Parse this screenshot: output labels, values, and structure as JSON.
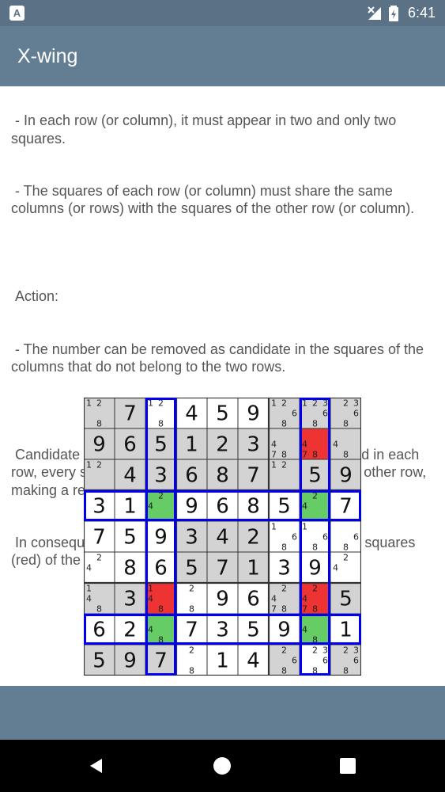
{
  "status_bar": {
    "app_icon_letter": "A",
    "time": "6:41"
  },
  "app_bar": {
    "title": "X-wing"
  },
  "description": {
    "paragraphs": [
      " - In each row (or column), it must appear in two and only two squares.",
      " - The squares of each row (or column) must share the same columns (or rows) with the squares of the other row (or column).",
      "",
      " Action:",
      " - The number can be removed as candidate in the squares of the columns that do not belong to the two rows.",
      "",
      " Candidate 4 appears only twice in the marked rows, and in each row, every square shares column with the square of the other row, making a rectangle (green squares).",
      " In consequence, 4 can be removed as candidate in the squares (red) of the columns that do not belong to the two rows:"
    ]
  },
  "sudoku": {
    "cells": [
      [
        "c:12 8",
        "7",
        "c:12 8",
        "4",
        "5",
        "9",
        "c:12 6 8",
        "c:123 6 8",
        "c:23 6 8"
      ],
      [
        "9",
        "6",
        "5",
        "1",
        "2",
        "3",
        "c:4 78",
        "c:4 78",
        "c:4 8"
      ],
      [
        "c:12",
        "4",
        "3",
        "6",
        "8",
        "7",
        "c:12",
        "5",
        "9"
      ],
      [
        "3",
        "1",
        "c:4 2",
        "9",
        "6",
        "8",
        "5",
        "c:4 2",
        "7"
      ],
      [
        "7",
        "5",
        "9",
        "3",
        "4",
        "2",
        "c:1 6 8",
        "c:1 6 8",
        "c:6 8"
      ],
      [
        "c:4 2",
        "8",
        "6",
        "5",
        "7",
        "1",
        "3",
        "9",
        "c:4 2"
      ],
      [
        "c:1 4 8",
        "3",
        "c:1 4 8",
        "c:2 8",
        "9",
        "6",
        "c:2 4 78",
        "c:2 4 78",
        "5"
      ],
      [
        "6",
        "2",
        "c:4 8",
        "7",
        "3",
        "5",
        "9",
        "c:4 8",
        "1"
      ],
      [
        "5",
        "9",
        "7",
        "c:2 8",
        "1",
        "4",
        "c:2 6 8",
        "c:23 6 8",
        "c:23 6 8"
      ]
    ],
    "gray_cells": [
      [
        0,
        0
      ],
      [
        0,
        1
      ],
      [
        0,
        6
      ],
      [
        0,
        7
      ],
      [
        0,
        8
      ],
      [
        1,
        0
      ],
      [
        1,
        1
      ],
      [
        1,
        2
      ],
      [
        1,
        3
      ],
      [
        1,
        4
      ],
      [
        1,
        5
      ],
      [
        1,
        6
      ],
      [
        1,
        8
      ],
      [
        2,
        0
      ],
      [
        2,
        1
      ],
      [
        2,
        2
      ],
      [
        2,
        3
      ],
      [
        2,
        4
      ],
      [
        2,
        5
      ],
      [
        2,
        6
      ],
      [
        2,
        7
      ],
      [
        2,
        8
      ],
      [
        4,
        3
      ],
      [
        4,
        4
      ],
      [
        4,
        5
      ],
      [
        5,
        3
      ],
      [
        5,
        4
      ],
      [
        5,
        5
      ],
      [
        6,
        0
      ],
      [
        6,
        1
      ],
      [
        6,
        6
      ],
      [
        6,
        8
      ],
      [
        8,
        0
      ],
      [
        8,
        1
      ],
      [
        8,
        2
      ],
      [
        8,
        6
      ],
      [
        8,
        8
      ]
    ],
    "green_cells": [
      [
        3,
        2
      ],
      [
        3,
        7
      ],
      [
        7,
        2
      ],
      [
        7,
        7
      ]
    ],
    "red_cells": [
      [
        1,
        7
      ],
      [
        6,
        2
      ],
      [
        6,
        7
      ]
    ],
    "highlight_rows": [
      3,
      7
    ],
    "highlight_cols": [
      2,
      7
    ],
    "colors": {
      "gray": "#d3d3d3",
      "green": "#66cc66",
      "red": "#ee3333",
      "blue": "#0000ee",
      "grid": "#333333"
    }
  },
  "navigation": {
    "back_icon": "back-triangle-icon",
    "home_icon": "home-circle-icon",
    "recents_icon": "recents-square-icon"
  }
}
